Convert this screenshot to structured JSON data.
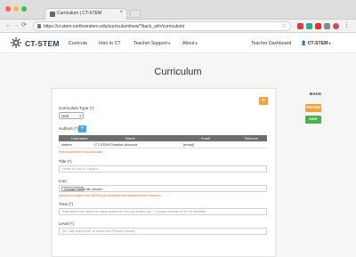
{
  "browser": {
    "tab_title": "Curriculum | CT-STEM",
    "tab_close": "×",
    "url": "https://ct-stem.northwestern.edu/curriculum/new/?back_url=/curriculum/",
    "back": "←",
    "forward": "→",
    "reload": "⟳",
    "star": "☆"
  },
  "site": {
    "logo_text": "CT-STEM",
    "nav": {
      "curricula": "Curricula",
      "intro": "Intro to CT",
      "teacher_support": "Teacher Support",
      "about": "About",
      "dashboard": "Teacher Dashboard",
      "account": "CT-STEM",
      "caret": "▾"
    }
  },
  "page": {
    "title": "Curriculum",
    "sidebar": {
      "back": "BACK",
      "preview": "PREVIEW",
      "save": "SAVE"
    },
    "gear_icon": "⚙",
    "curriculum_type_label": "Curriculum Type (*)",
    "curriculum_type_value": "Unit",
    "authors_label": "Authors (*)",
    "add_author": "+",
    "authors_table": {
      "headers": [
        "Username",
        "Name",
        "Email",
        "Remove"
      ],
      "rows": [
        [
          "ctstem",
          "CT-STEM Teacher Account",
          "[email]",
          ""
        ]
      ]
    },
    "authors_help": "Select authors for this curriculum",
    "title_label": "Title (*)",
    "title_placeholder": "Name of Unit or Lesson",
    "icon_label": "Icon",
    "file_button": "Choose File",
    "file_status": "No file chosen",
    "icon_help": "Upload an image in the 400x289 px resolution that represents the curriculum",
    "time_label": "Time (*)",
    "time_placeholder": "Estimated time students would spend on this curriculum (ex. 7-9 class periods of 45-50 minutes)",
    "level_label": "Level (*)",
    "level_placeholder": "(ex. high school AP or Advanced Physics course)"
  },
  "colors": {
    "primary": "#4aa8d8",
    "preview": "#f0a23a",
    "save": "#4caf50",
    "help_text": "#e0623f",
    "table_header": "#6e6e6e"
  }
}
